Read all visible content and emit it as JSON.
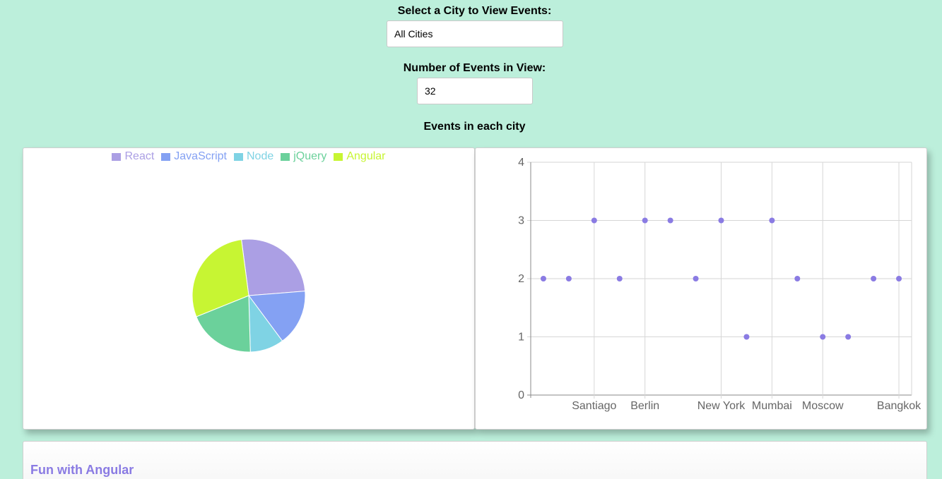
{
  "city_select": {
    "label": "Select a City to View Events:",
    "value": "All Cities"
  },
  "events_count": {
    "label": "Number of Events in View:",
    "value": "32"
  },
  "section_title": "Events in each city",
  "bottom_card": {
    "title": "Fun with Angular",
    "title_color": "#8a7be3"
  },
  "chart_data": [
    {
      "type": "pie",
      "legend_position": "top",
      "categories": [
        "React",
        "JavaScript",
        "Node",
        "jQuery",
        "Angular"
      ],
      "values": [
        8,
        5,
        3,
        6,
        9
      ],
      "colors": [
        "#ab9fe4",
        "#84a1f3",
        "#7fd3e4",
        "#6bd19b",
        "#c7f533"
      ]
    },
    {
      "type": "scatter",
      "categories": [
        "",
        "",
        "Santiago",
        "",
        "Berlin",
        "",
        "",
        "New York",
        "",
        "Mumbai",
        "",
        "Moscow",
        "",
        "",
        "Bangkok"
      ],
      "values": [
        2,
        2,
        3,
        2,
        3,
        3,
        2,
        3,
        1,
        3,
        2,
        1,
        1,
        2,
        2
      ],
      "ylim": [
        0,
        4
      ],
      "yticks": [
        0,
        1,
        2,
        3,
        4
      ],
      "grid": true,
      "point_color": "#8a7be3"
    }
  ]
}
